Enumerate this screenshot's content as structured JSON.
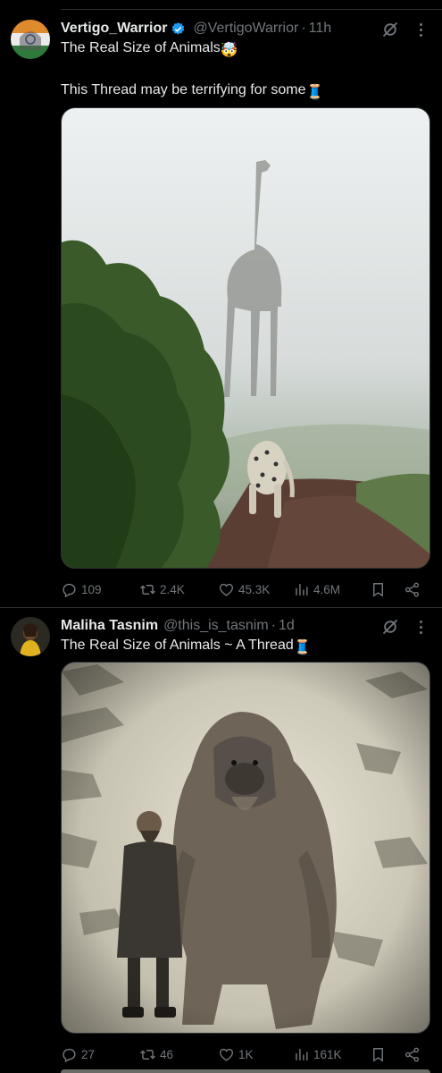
{
  "tweets": [
    {
      "name": "Vertigo_Warrior",
      "handle": "@VertigoWarrior",
      "time": "11h",
      "line1": "The Real Size of Animals",
      "line1_emoji": "🤯",
      "line2": "This Thread may be terrifying for some",
      "line2_emoji": "🧵",
      "stats": {
        "replies": "109",
        "reposts": "2.4K",
        "likes": "45.3K",
        "views": "4.6M"
      },
      "media_icon": "giraffe-leopard-fog-photo"
    },
    {
      "name": "Maliha Tasnim",
      "handle": "@this_is_tasnim",
      "time": "1d",
      "line1": "The Real Size of Animals ~ A Thread",
      "line1_emoji": "🧵",
      "stats": {
        "replies": "27",
        "reposts": "46",
        "likes": "1K",
        "views": "161K"
      },
      "media_icon": "giant-ape-man-snow-photo"
    }
  ],
  "colors": {
    "background": "#000000",
    "text": "#e7e9ea",
    "muted": "#71767b",
    "verified": "#1d9bf0",
    "border": "#2f3336"
  }
}
